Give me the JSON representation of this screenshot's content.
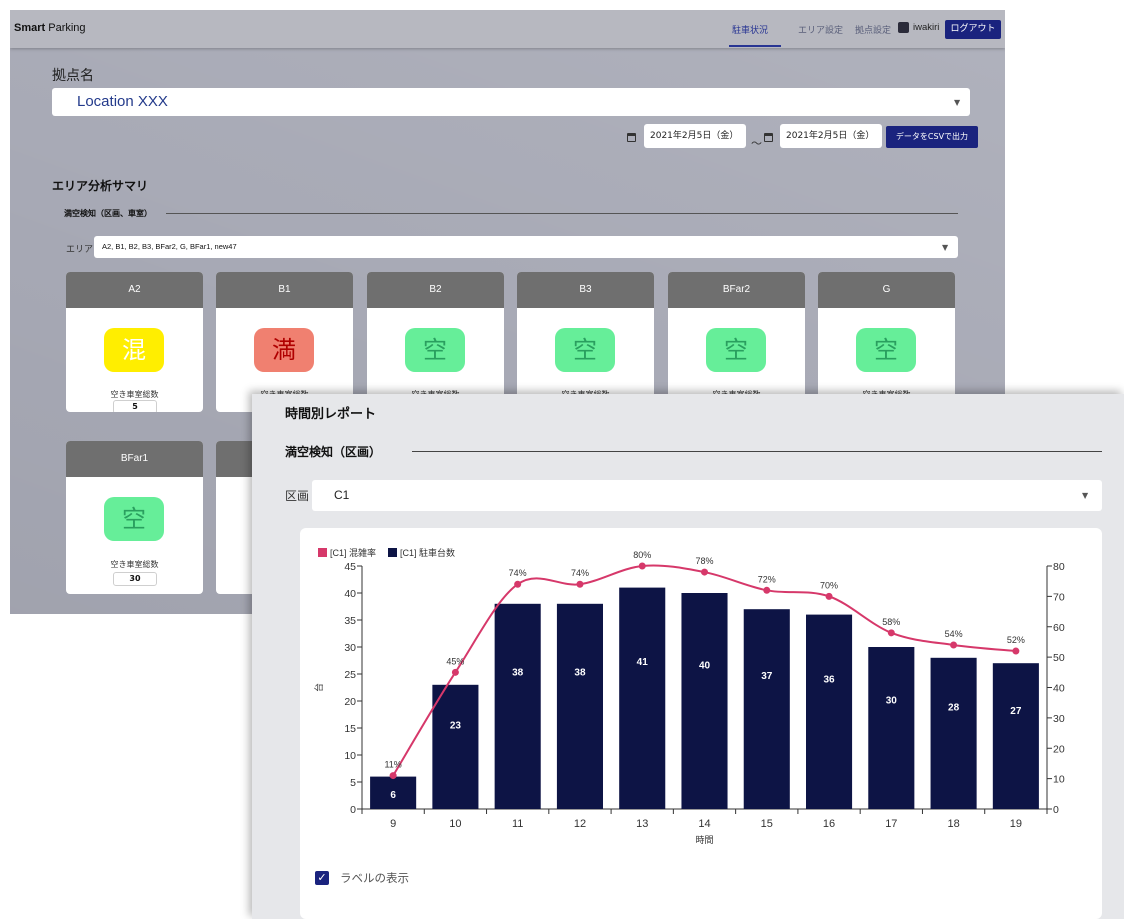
{
  "back": {
    "brand": {
      "bold": "Smart",
      "rest": " Parking"
    },
    "nav": [
      "駐車状況",
      "エリア設定",
      "拠点設定"
    ],
    "user": "iwakiri",
    "logout": "ログアウト",
    "location_label": "拠点名",
    "location_value": "Location XXX",
    "date_from": "2021年2月5日（金）",
    "date_sep": "〜",
    "date_to": "2021年2月5日（金）",
    "csv_button": "データをCSVで出力",
    "summary_title": "エリア分析サマリ",
    "sub_title": "満空検知（区画、車室）",
    "area_label": "エリア",
    "area_value": "A2, B1, B2, B3, BFar2, G, BFar1, new47",
    "cards": [
      {
        "name": "A2",
        "status": "混",
        "status_type": "mix",
        "count_label": "空き車室総数",
        "count": "5"
      },
      {
        "name": "B1",
        "status": "満",
        "status_type": "full",
        "count_label": "空き車室総数",
        "count": ""
      },
      {
        "name": "B2",
        "status": "空",
        "status_type": "empty",
        "count_label": "空き車室総数",
        "count": ""
      },
      {
        "name": "B3",
        "status": "空",
        "status_type": "empty",
        "count_label": "空き車室総数",
        "count": ""
      },
      {
        "name": "BFar2",
        "status": "空",
        "status_type": "empty",
        "count_label": "空き車室総数",
        "count": ""
      },
      {
        "name": "G",
        "status": "空",
        "status_type": "empty",
        "count_label": "空き車室総数",
        "count": ""
      },
      {
        "name": "BFar1",
        "status": "空",
        "status_type": "empty",
        "count_label": "空き車室総数",
        "count": "30"
      }
    ]
  },
  "report": {
    "title": "時間別レポート",
    "section_title": "満空検知（区画）",
    "division_label": "区画",
    "division_value": "C1",
    "show_labels": "ラベルの表示"
  },
  "colors": {
    "bar": "#0d1445",
    "line": "#d6386a",
    "accent": "#1a237e"
  },
  "chart_data": {
    "type": "bar+line",
    "categories": [
      "9",
      "10",
      "11",
      "12",
      "13",
      "14",
      "15",
      "16",
      "17",
      "18",
      "19"
    ],
    "series": [
      {
        "name": "[C1] 混雑率",
        "type": "line",
        "axis": "right",
        "values": [
          11,
          45,
          74,
          74,
          80,
          78,
          72,
          70,
          58,
          54,
          52
        ],
        "label_suffix": "%"
      },
      {
        "name": "[C1] 駐車台数",
        "type": "bar",
        "axis": "left",
        "values": [
          6,
          23,
          38,
          38,
          41,
          40,
          37,
          36,
          30,
          28,
          27
        ]
      }
    ],
    "xlabel": "時間",
    "ylabel": "台",
    "ylim": [
      0,
      45
    ],
    "y2lim": [
      0,
      80
    ],
    "yticks": [
      0,
      5,
      10,
      15,
      20,
      25,
      30,
      35,
      40,
      45
    ],
    "y2ticks": [
      0,
      10,
      20,
      30,
      40,
      50,
      60,
      70,
      80
    ],
    "legend_position": "top-left",
    "grid": false
  }
}
